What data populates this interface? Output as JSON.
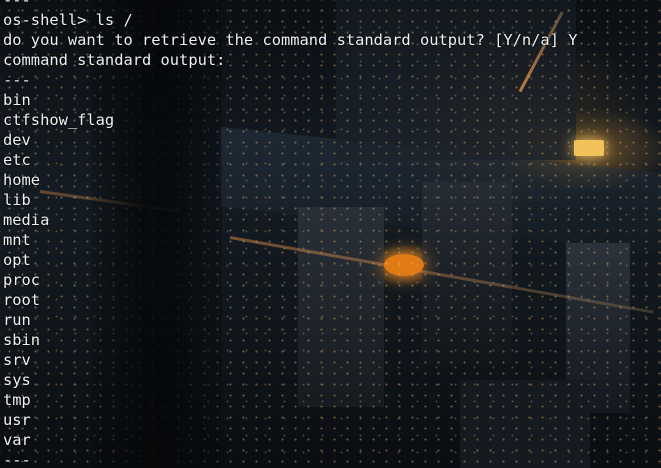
{
  "terminal": {
    "top_separator": "---",
    "prompt": "os-shell> ls /",
    "question": "do you want to retrieve the command standard output? [Y/n/a] Y",
    "output_header": "command standard output:",
    "separator": "---",
    "entries": [
      "bin",
      "ctfshow_flag",
      "dev",
      "etc",
      "home",
      "lib",
      "media",
      "mnt",
      "opt",
      "proc",
      "root",
      "run",
      "sbin",
      "srv",
      "sys",
      "tmp",
      "usr",
      "var"
    ],
    "bottom_separator": "---"
  },
  "colors": {
    "text": "#eef1f4",
    "accent_light": "#e07a14"
  }
}
